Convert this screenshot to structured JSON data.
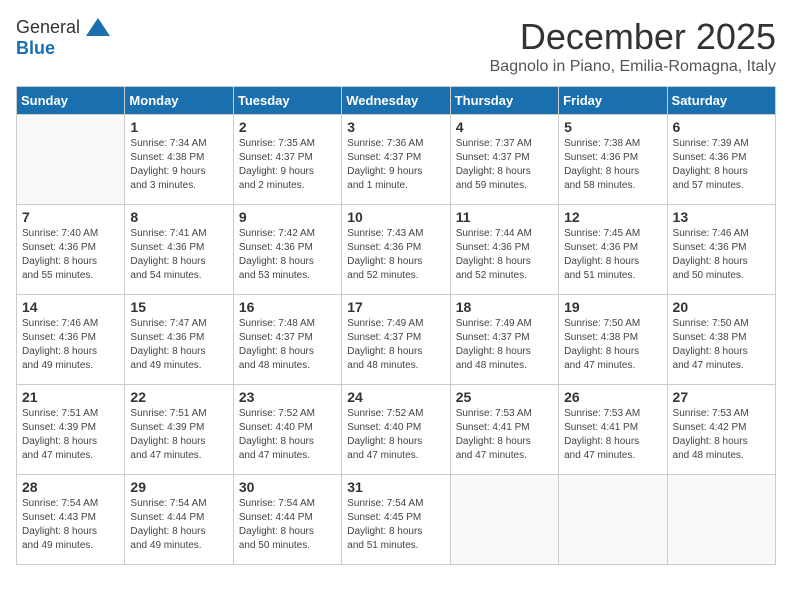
{
  "logo": {
    "general": "General",
    "blue": "Blue"
  },
  "title": "December 2025",
  "location": "Bagnolo in Piano, Emilia-Romagna, Italy",
  "weekdays": [
    "Sunday",
    "Monday",
    "Tuesday",
    "Wednesday",
    "Thursday",
    "Friday",
    "Saturday"
  ],
  "weeks": [
    [
      {
        "day": "",
        "info": ""
      },
      {
        "day": "1",
        "info": "Sunrise: 7:34 AM\nSunset: 4:38 PM\nDaylight: 9 hours\nand 3 minutes."
      },
      {
        "day": "2",
        "info": "Sunrise: 7:35 AM\nSunset: 4:37 PM\nDaylight: 9 hours\nand 2 minutes."
      },
      {
        "day": "3",
        "info": "Sunrise: 7:36 AM\nSunset: 4:37 PM\nDaylight: 9 hours\nand 1 minute."
      },
      {
        "day": "4",
        "info": "Sunrise: 7:37 AM\nSunset: 4:37 PM\nDaylight: 8 hours\nand 59 minutes."
      },
      {
        "day": "5",
        "info": "Sunrise: 7:38 AM\nSunset: 4:36 PM\nDaylight: 8 hours\nand 58 minutes."
      },
      {
        "day": "6",
        "info": "Sunrise: 7:39 AM\nSunset: 4:36 PM\nDaylight: 8 hours\nand 57 minutes."
      }
    ],
    [
      {
        "day": "7",
        "info": "Sunrise: 7:40 AM\nSunset: 4:36 PM\nDaylight: 8 hours\nand 55 minutes."
      },
      {
        "day": "8",
        "info": "Sunrise: 7:41 AM\nSunset: 4:36 PM\nDaylight: 8 hours\nand 54 minutes."
      },
      {
        "day": "9",
        "info": "Sunrise: 7:42 AM\nSunset: 4:36 PM\nDaylight: 8 hours\nand 53 minutes."
      },
      {
        "day": "10",
        "info": "Sunrise: 7:43 AM\nSunset: 4:36 PM\nDaylight: 8 hours\nand 52 minutes."
      },
      {
        "day": "11",
        "info": "Sunrise: 7:44 AM\nSunset: 4:36 PM\nDaylight: 8 hours\nand 52 minutes."
      },
      {
        "day": "12",
        "info": "Sunrise: 7:45 AM\nSunset: 4:36 PM\nDaylight: 8 hours\nand 51 minutes."
      },
      {
        "day": "13",
        "info": "Sunrise: 7:46 AM\nSunset: 4:36 PM\nDaylight: 8 hours\nand 50 minutes."
      }
    ],
    [
      {
        "day": "14",
        "info": "Sunrise: 7:46 AM\nSunset: 4:36 PM\nDaylight: 8 hours\nand 49 minutes."
      },
      {
        "day": "15",
        "info": "Sunrise: 7:47 AM\nSunset: 4:36 PM\nDaylight: 8 hours\nand 49 minutes."
      },
      {
        "day": "16",
        "info": "Sunrise: 7:48 AM\nSunset: 4:37 PM\nDaylight: 8 hours\nand 48 minutes."
      },
      {
        "day": "17",
        "info": "Sunrise: 7:49 AM\nSunset: 4:37 PM\nDaylight: 8 hours\nand 48 minutes."
      },
      {
        "day": "18",
        "info": "Sunrise: 7:49 AM\nSunset: 4:37 PM\nDaylight: 8 hours\nand 48 minutes."
      },
      {
        "day": "19",
        "info": "Sunrise: 7:50 AM\nSunset: 4:38 PM\nDaylight: 8 hours\nand 47 minutes."
      },
      {
        "day": "20",
        "info": "Sunrise: 7:50 AM\nSunset: 4:38 PM\nDaylight: 8 hours\nand 47 minutes."
      }
    ],
    [
      {
        "day": "21",
        "info": "Sunrise: 7:51 AM\nSunset: 4:39 PM\nDaylight: 8 hours\nand 47 minutes."
      },
      {
        "day": "22",
        "info": "Sunrise: 7:51 AM\nSunset: 4:39 PM\nDaylight: 8 hours\nand 47 minutes."
      },
      {
        "day": "23",
        "info": "Sunrise: 7:52 AM\nSunset: 4:40 PM\nDaylight: 8 hours\nand 47 minutes."
      },
      {
        "day": "24",
        "info": "Sunrise: 7:52 AM\nSunset: 4:40 PM\nDaylight: 8 hours\nand 47 minutes."
      },
      {
        "day": "25",
        "info": "Sunrise: 7:53 AM\nSunset: 4:41 PM\nDaylight: 8 hours\nand 47 minutes."
      },
      {
        "day": "26",
        "info": "Sunrise: 7:53 AM\nSunset: 4:41 PM\nDaylight: 8 hours\nand 47 minutes."
      },
      {
        "day": "27",
        "info": "Sunrise: 7:53 AM\nSunset: 4:42 PM\nDaylight: 8 hours\nand 48 minutes."
      }
    ],
    [
      {
        "day": "28",
        "info": "Sunrise: 7:54 AM\nSunset: 4:43 PM\nDaylight: 8 hours\nand 49 minutes."
      },
      {
        "day": "29",
        "info": "Sunrise: 7:54 AM\nSunset: 4:44 PM\nDaylight: 8 hours\nand 49 minutes."
      },
      {
        "day": "30",
        "info": "Sunrise: 7:54 AM\nSunset: 4:44 PM\nDaylight: 8 hours\nand 50 minutes."
      },
      {
        "day": "31",
        "info": "Sunrise: 7:54 AM\nSunset: 4:45 PM\nDaylight: 8 hours\nand 51 minutes."
      },
      {
        "day": "",
        "info": ""
      },
      {
        "day": "",
        "info": ""
      },
      {
        "day": "",
        "info": ""
      }
    ]
  ]
}
